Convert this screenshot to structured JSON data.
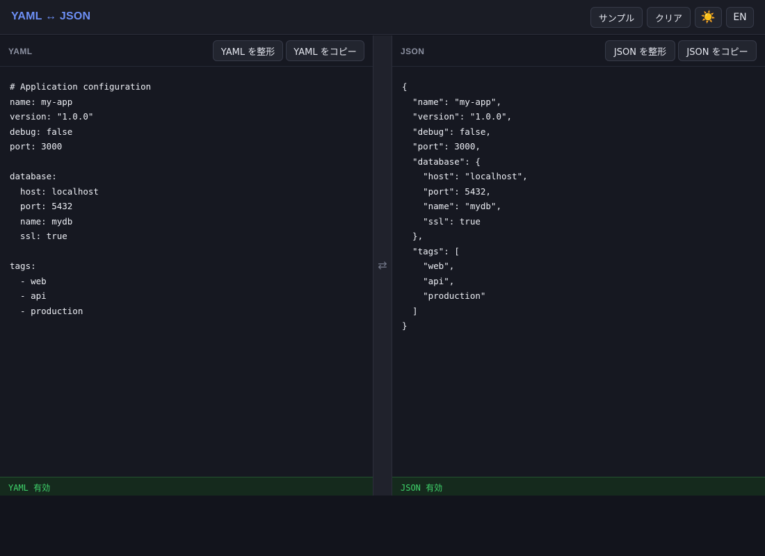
{
  "header": {
    "title": "YAML ↔ JSON",
    "sample_label": "サンプル",
    "clear_label": "クリア",
    "theme_icon": "☀️",
    "lang_label": "EN"
  },
  "yaml_pane": {
    "label": "YAML",
    "format_label": "YAML を整形",
    "copy_label": "YAML をコピー",
    "content": "# Application configuration\nname: my-app\nversion: \"1.0.0\"\ndebug: false\nport: 3000\n\ndatabase:\n  host: localhost\n  port: 5432\n  name: mydb\n  ssl: true\n\ntags:\n  - web\n  - api\n  - production",
    "status": "YAML 有効"
  },
  "json_pane": {
    "label": "JSON",
    "format_label": "JSON を整形",
    "copy_label": "JSON をコピー",
    "content": "{\n  \"name\": \"my-app\",\n  \"version\": \"1.0.0\",\n  \"debug\": false,\n  \"port\": 3000,\n  \"database\": {\n    \"host\": \"localhost\",\n    \"port\": 5432,\n    \"name\": \"mydb\",\n    \"ssl\": true\n  },\n  \"tags\": [\n    \"web\",\n    \"api\",\n    \"production\"\n  ]\n}",
    "status": "JSON 有効"
  },
  "divider": {
    "icon": "⇄"
  },
  "colors": {
    "accent": "#6d8ff5",
    "valid_status": "#3fd46b"
  }
}
